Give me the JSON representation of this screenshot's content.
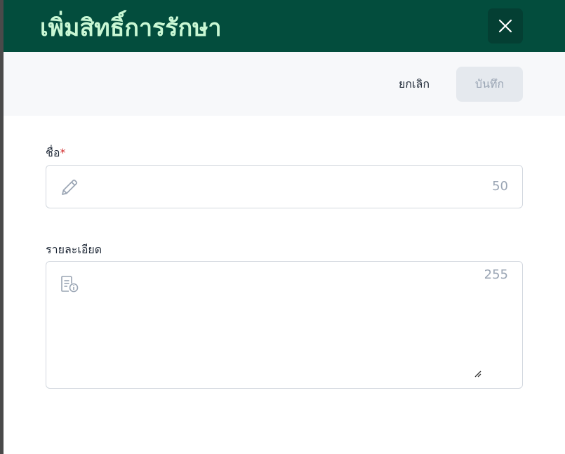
{
  "dialog": {
    "title": "เพิ่มสิทธิ์การรักษา"
  },
  "toolbar": {
    "cancel_label": "ยกเลิก",
    "save_label": "บันทึก"
  },
  "form": {
    "name_label": "ชื่อ",
    "name_required_mark": "*",
    "name_max_length": "50",
    "name_value": "",
    "description_label": "รายละเอียด",
    "description_max_length": "255",
    "description_value": ""
  },
  "colors": {
    "header_bg": "#034d3d",
    "title_text": "#c9f7d4",
    "required": "#d32f2f"
  },
  "icons": {
    "close": "close-icon",
    "name_field": "pencil-icon",
    "description_field": "document-info-icon",
    "resize": "resize-handle-icon"
  }
}
